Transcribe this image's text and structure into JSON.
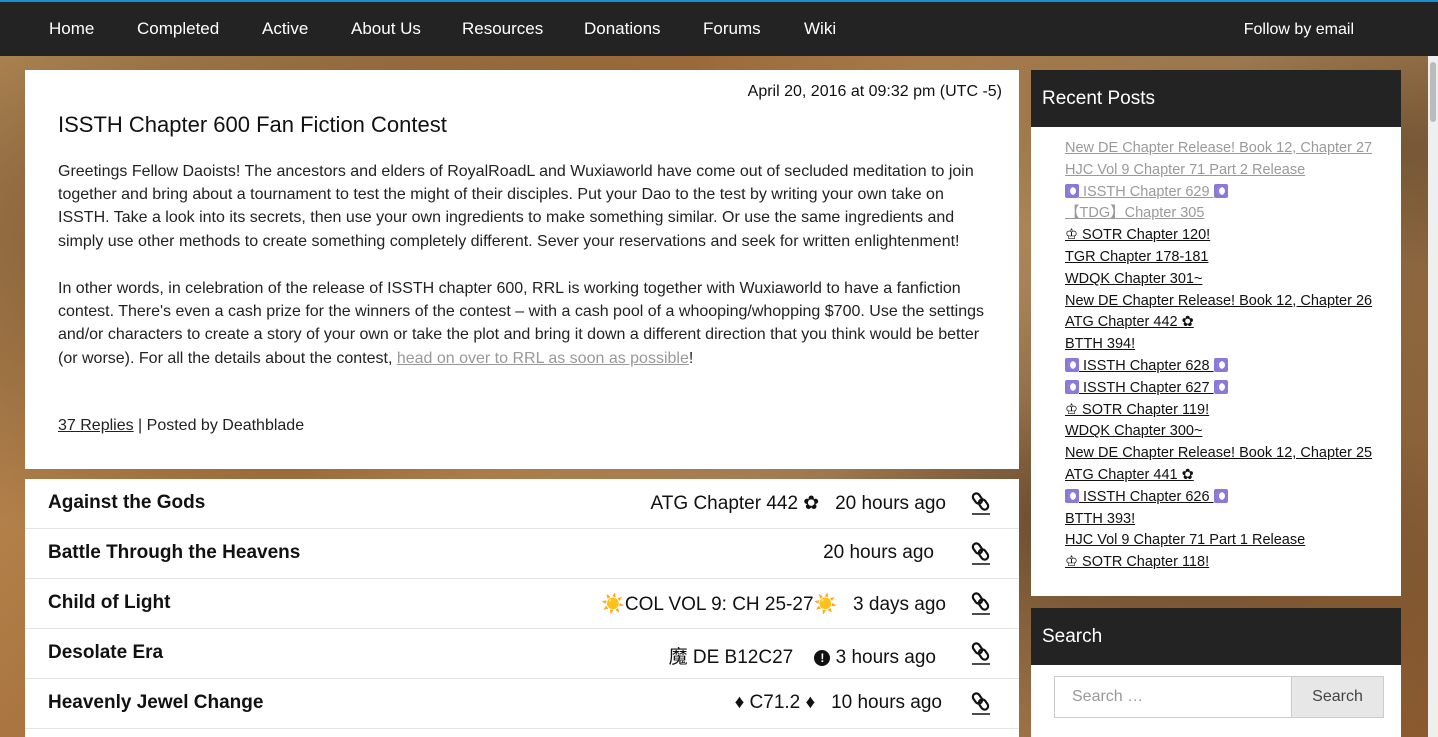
{
  "nav": {
    "items": [
      "Home",
      "Completed",
      "Active",
      "About Us",
      "Resources",
      "Donations",
      "Forums",
      "Wiki"
    ],
    "follow": "Follow by email"
  },
  "post": {
    "date": "April 20, 2016 at 09:32 pm (UTC -5)",
    "title": "ISSTH Chapter 600 Fan Fiction Contest",
    "p1": "Greetings Fellow Daoists! The ancestors and elders of RoyalRoadL and Wuxiaworld have come out of secluded meditation to join together and bring about a tournament to test the might of their disciples. Put your Dao to the test by writing your own take on ISSTH. Take a look into its secrets, then use your own ingredients to make something similar. Or use the same ingredients and simply use other methods to create something completely different. Sever your reservations and seek for written enlightenment!",
    "p2_text": "In other words, in celebration of the release of ISSTH chapter 600, RRL is working together with Wuxiaworld to have a fanfiction contest. There's even a cash prize for the winners of the contest – with a cash pool of a whooping/whopping $700. Use the settings and/or characters to create a story of your own or take the plot and bring it down a different direction that you think would be better (or worse). For all the details about the contest, ",
    "p2_link": "head on over to RRL as soon as possible",
    "p2_end": "!",
    "replies": "37 Replies",
    "posted_by": " | Posted by Deathblade"
  },
  "series": [
    {
      "name": "Against the Gods",
      "latest": "ATG Chapter 442 ✿",
      "time": "20 hours ago"
    },
    {
      "name": "Battle Through the Heavens",
      "latest": "",
      "time": "20 hours ago"
    },
    {
      "name": "Child of Light",
      "latest": "☀️COL VOL 9: CH 25-27☀️",
      "time": "3 days ago"
    },
    {
      "name": "Desolate Era",
      "latest": "魔 DE B12C27",
      "time": "3 hours ago"
    },
    {
      "name": "Heavenly Jewel Change",
      "latest": "♦ C71.2 ♦",
      "time": "10 hours ago"
    }
  ],
  "sidebar": {
    "recent_title": "Recent Posts",
    "recent_posts": [
      {
        "text": "New DE Chapter Release! Book 12, Chapter 27",
        "visited": true
      },
      {
        "text": "HJC Vol 9 Chapter 71 Part 2 Release",
        "visited": true
      },
      {
        "text": " ISSTH Chapter 629 ",
        "visited": true,
        "moon": true
      },
      {
        "text": "【TDG】Chapter 305",
        "visited": true
      },
      {
        "text": "♔ SOTR Chapter 120!",
        "visited": false
      },
      {
        "text": "TGR Chapter 178-181",
        "visited": false
      },
      {
        "text": "WDQK Chapter 301~",
        "visited": false
      },
      {
        "text": "New DE Chapter Release! Book 12, Chapter 26",
        "visited": false
      },
      {
        "text": "ATG Chapter 442 ✿",
        "visited": false
      },
      {
        "text": "BTTH 394!",
        "visited": false
      },
      {
        "text": " ISSTH Chapter 628 ",
        "visited": false,
        "moon": true
      },
      {
        "text": " ISSTH Chapter 627 ",
        "visited": false,
        "moon": true
      },
      {
        "text": "♔ SOTR Chapter 119!",
        "visited": false
      },
      {
        "text": "WDQK Chapter 300~",
        "visited": false
      },
      {
        "text": "New DE Chapter Release! Book 12, Chapter 25",
        "visited": false
      },
      {
        "text": "ATG Chapter 441 ✿",
        "visited": false
      },
      {
        "text": " ISSTH Chapter 626 ",
        "visited": false,
        "moon": true
      },
      {
        "text": "BTTH 393!",
        "visited": false
      },
      {
        "text": "HJC Vol 9 Chapter 71 Part 1 Release",
        "visited": false
      },
      {
        "text": "♔ SOTR Chapter 118!",
        "visited": false
      }
    ],
    "search_title": "Search",
    "search_placeholder": "Search …",
    "search_button": "Search"
  },
  "colors": {
    "nav_bg": "#232323",
    "accent": "#1a8fd0",
    "visited_link": "#9a9a9a",
    "moon_icon": "#8b78d8"
  }
}
